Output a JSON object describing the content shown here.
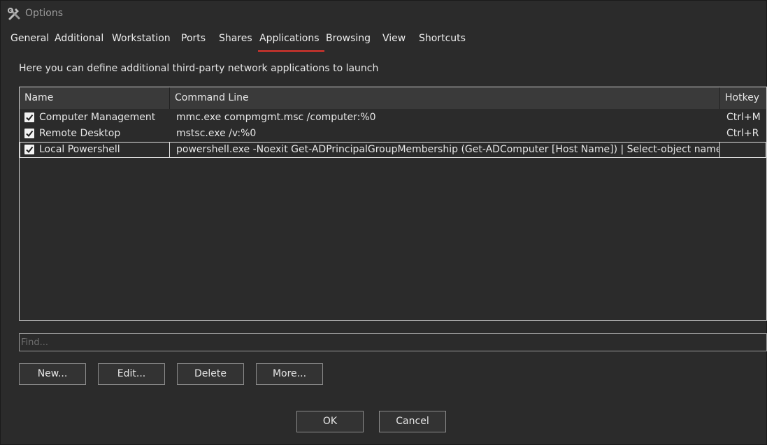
{
  "window": {
    "title": "Options",
    "icon": "tools-icon"
  },
  "tabs": [
    {
      "label": "General"
    },
    {
      "label": "Additional"
    },
    {
      "label": "Workstation"
    },
    {
      "label": "Ports"
    },
    {
      "label": "Shares"
    },
    {
      "label": "Applications",
      "selected": true
    },
    {
      "label": "Browsing"
    },
    {
      "label": "View"
    },
    {
      "label": "Shortcuts"
    }
  ],
  "description": "Here you can define additional third-party network applications to launch",
  "table": {
    "columns": [
      "Name",
      "Command Line",
      "Hotkey"
    ],
    "rows": [
      {
        "checked": true,
        "name": "Computer Management",
        "command": "mmc.exe compmgmt.msc /computer:%0",
        "hotkey": "Ctrl+M"
      },
      {
        "checked": true,
        "name": "Remote Desktop",
        "command": "mstsc.exe /v:%0",
        "hotkey": "Ctrl+R"
      },
      {
        "checked": true,
        "name": "Local Powershell",
        "command": "powershell.exe -Noexit Get-ADPrincipalGroupMembership (Get-ADComputer [Host Name]) | Select-object name",
        "hotkey": "",
        "selected": true
      }
    ]
  },
  "find": {
    "placeholder": "Find...",
    "value": ""
  },
  "actions": {
    "new": "New...",
    "edit": "Edit...",
    "delete": "Delete",
    "more": "More..."
  },
  "dialog": {
    "ok": "OK",
    "cancel": "Cancel"
  },
  "colors": {
    "background": "#2b2b2b",
    "header": "#3a3a3a",
    "accent": "#e0342c",
    "text": "#e6e6e6"
  }
}
